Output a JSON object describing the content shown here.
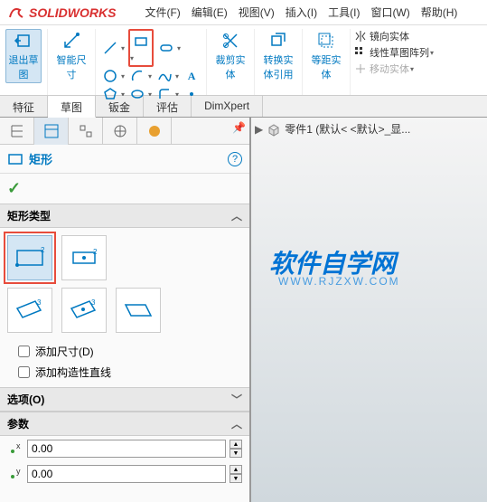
{
  "app": {
    "name": "SOLIDWORKS"
  },
  "menu": {
    "file": "文件(F)",
    "edit": "编辑(E)",
    "view": "视图(V)",
    "insert": "插入(I)",
    "tools": "工具(I)",
    "window": "窗口(W)",
    "help": "帮助(H)"
  },
  "ribbon": {
    "exit_sketch": "退出草图",
    "smart_dim": "智能尺寸",
    "trim_ent": "裁剪实体",
    "convert_ent": "转换实体引用",
    "offset_ent": "等距实体",
    "mirror_ent": "镜向实体",
    "linear_pattern": "线性草图阵列",
    "move_ent": "移动实体"
  },
  "tabs": {
    "feature": "特征",
    "sketch": "草图",
    "sheetmetal": "钣金",
    "evaluate": "评估",
    "dimxpert": "DimXpert"
  },
  "panel": {
    "title": "矩形",
    "rect_types": "矩形类型",
    "add_dim": "添加尺寸(D)",
    "add_const": "添加构造性直线",
    "options": "选项(O)",
    "params": "参数",
    "x_val": "0.00",
    "y_val": "0.00"
  },
  "breadcrumb": {
    "part": "零件1 (默认< <默认>_显..."
  },
  "watermark": {
    "main": "软件自学网",
    "sub": "WWW.RJZXW.COM"
  }
}
